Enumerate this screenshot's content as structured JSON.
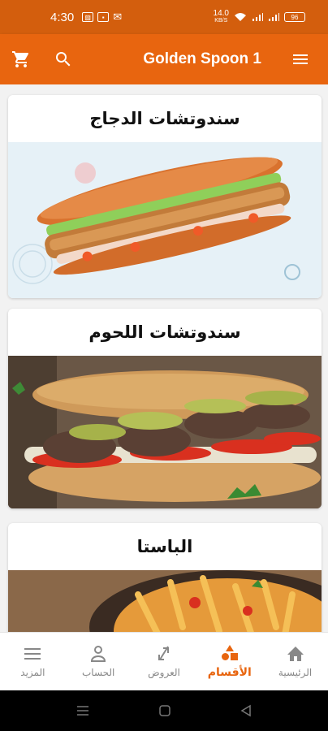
{
  "status_bar": {
    "time": "4:30",
    "speed": "14.0",
    "speed_unit": "KB/S",
    "battery": "96"
  },
  "app_bar": {
    "title": "Golden Spoon 1",
    "cart_icon": "cart-icon",
    "search_icon": "search-icon",
    "menu_icon": "menu-icon"
  },
  "categories": [
    {
      "title": "سندوتشات الدجاج",
      "image": "chicken-sandwich"
    },
    {
      "title": "سندوتشات اللحوم",
      "image": "meat-sandwich"
    },
    {
      "title": "الباستا",
      "image": "pasta"
    }
  ],
  "bottom_nav": {
    "home": "الرئيسية",
    "categories": "الأقسام",
    "offers": "العروض",
    "account": "الحساب",
    "more": "المزيد"
  },
  "colors": {
    "brand": "#e8650f",
    "status_bar": "#d35e0d",
    "inactive": "#888888"
  }
}
